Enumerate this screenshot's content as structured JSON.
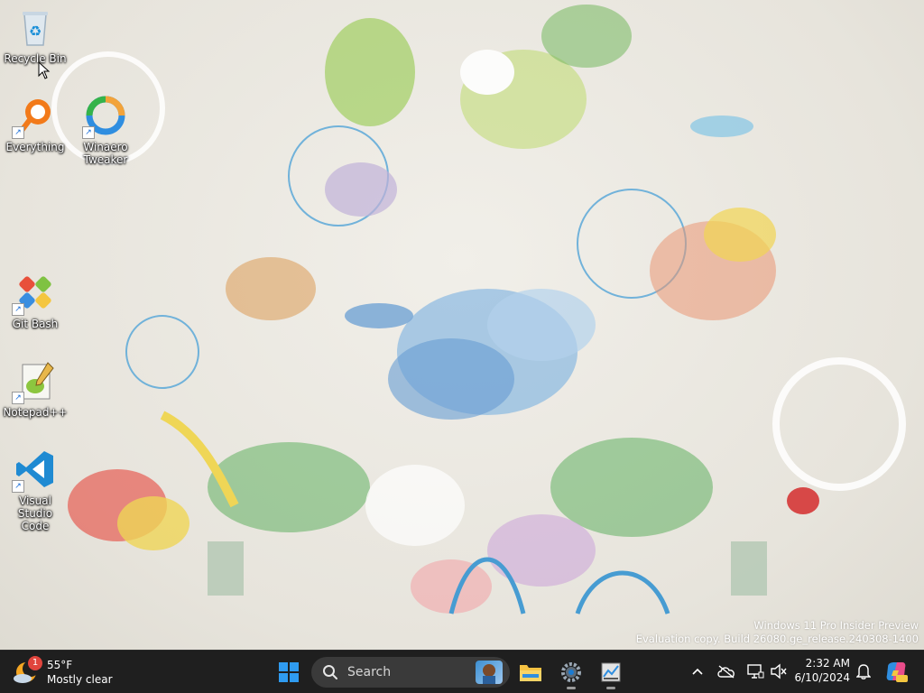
{
  "desktop": {
    "icons": [
      {
        "label": "Recycle Bin",
        "icon": "recycle-bin-icon"
      },
      {
        "label": "Everything",
        "icon": "everything-search-icon"
      },
      {
        "label": "Winaero\nTweaker",
        "icon": "winaero-tweaker-icon"
      },
      {
        "label": "Git Bash",
        "icon": "git-bash-icon"
      },
      {
        "label": "Notepad++",
        "icon": "notepad-plus-plus-icon"
      },
      {
        "label": "Visual Studio\nCode",
        "icon": "vscode-icon"
      }
    ],
    "watermark": {
      "line1": "Windows 11 Pro Insider Preview",
      "line2": "Evaluation copy. Build 26080.ge_release.240308-1400"
    }
  },
  "taskbar": {
    "weather": {
      "temperature": "55°F",
      "condition": "Mostly clear",
      "badge": "1"
    },
    "search": {
      "label": "Search"
    },
    "apps": [
      "start-icon",
      "file-explorer-icon",
      "settings-icon",
      "task-manager-icon"
    ],
    "tray": [
      "chevron-up-icon",
      "onedrive-offline-icon",
      "network-icon",
      "volume-muted-icon"
    ],
    "clock": {
      "time": "2:32 AM",
      "date": "6/10/2024"
    },
    "colors": {
      "taskbar": "#1f1f1f",
      "accent": "#0078d4"
    }
  }
}
